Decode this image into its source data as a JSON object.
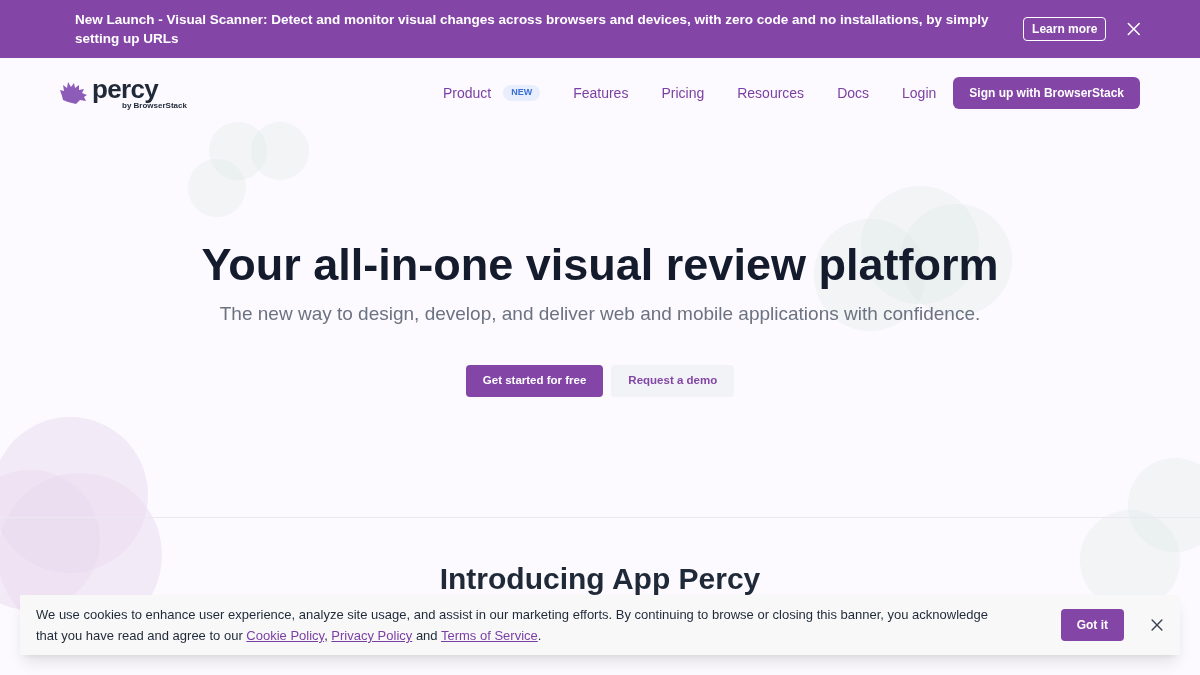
{
  "announcement": {
    "text": "New Launch - Visual Scanner: Detect and monitor visual changes across browsers and devices, with zero code and no installations, by simply setting up URLs",
    "button": "Learn more"
  },
  "logo": {
    "name": "percy",
    "tagline": "by BrowserStack"
  },
  "nav": {
    "items": [
      {
        "label": "Product",
        "badge": "NEW"
      },
      {
        "label": "Features"
      },
      {
        "label": "Pricing"
      },
      {
        "label": "Resources"
      },
      {
        "label": "Docs"
      },
      {
        "label": "Login"
      }
    ],
    "cta": "Sign up with BrowserStack"
  },
  "hero": {
    "title": "Your all-in-one visual review platform",
    "subtitle": "The new way to design, develop, and deliver web and mobile applications with confidence.",
    "buttons": [
      {
        "label": "Get started for free",
        "kind": "primary"
      },
      {
        "label": "Request a demo",
        "kind": "secondary"
      }
    ]
  },
  "section": {
    "heading": "Introducing App Percy"
  },
  "cookie_banner": {
    "parts": [
      {
        "kind": "text",
        "text": "We use cookies to enhance user experience, analyze site usage, and assist in our marketing efforts. By continuing to browse or closing this banner, you acknowledge that you have read and agree to our "
      },
      {
        "kind": "link",
        "text": "Cookie Policy"
      },
      {
        "kind": "text",
        "text": ", "
      },
      {
        "kind": "link",
        "text": "Privacy Policy"
      },
      {
        "kind": "text",
        "text": " and "
      },
      {
        "kind": "link",
        "text": "Terms of Service"
      },
      {
        "kind": "text",
        "text": "."
      }
    ],
    "button": "Got it"
  }
}
